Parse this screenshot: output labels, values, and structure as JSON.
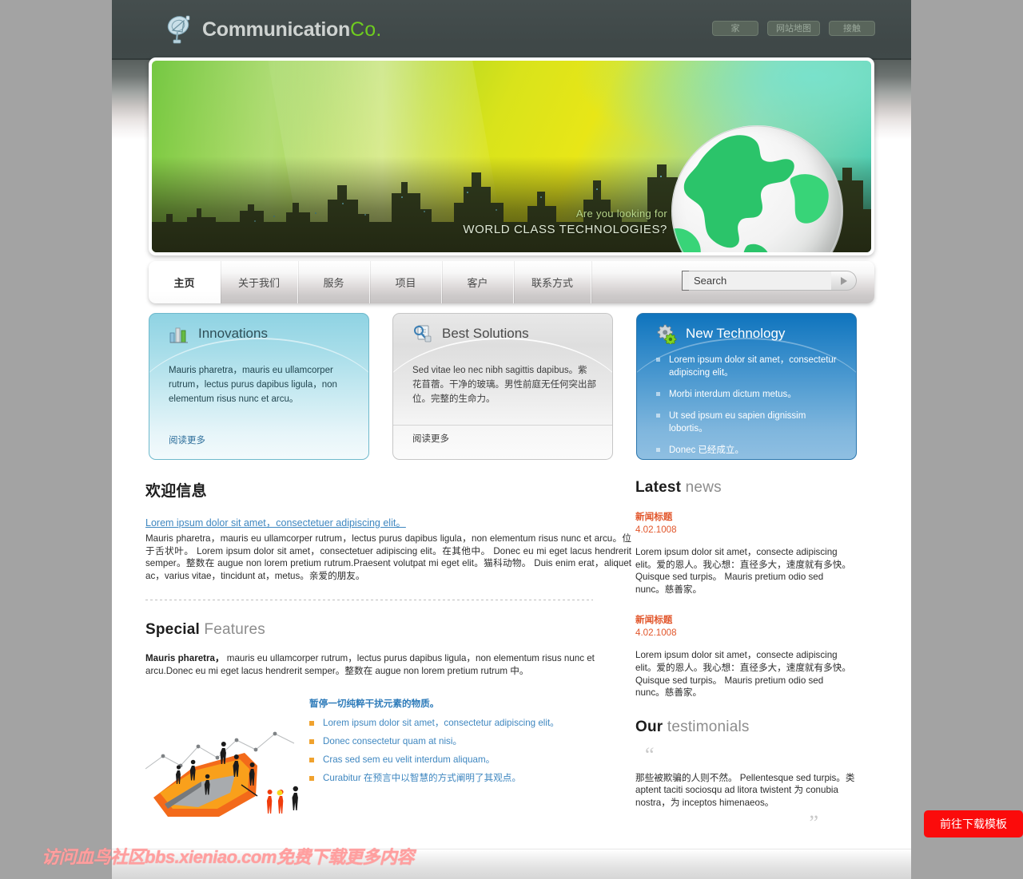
{
  "header": {
    "brand_main": "Communication",
    "brand_accent": "Co.",
    "logo_icon": "satellite-dish-icon",
    "top_links": [
      {
        "label": "家"
      },
      {
        "label": "网站地图"
      },
      {
        "label": "接触"
      }
    ]
  },
  "banner": {
    "line1": "Are you looking for",
    "line2": "WORLD CLASS TECHNOLOGIES?"
  },
  "nav": {
    "items": [
      {
        "label": "主页",
        "active": true
      },
      {
        "label": "关于我们",
        "active": false
      },
      {
        "label": "服务",
        "active": false
      },
      {
        "label": "项目",
        "active": false
      },
      {
        "label": "客户",
        "active": false
      },
      {
        "label": "联系方式",
        "active": false
      }
    ],
    "search": {
      "value": "Search",
      "placeholder": "Search",
      "button_icon": "arrow-right-icon"
    }
  },
  "promos": [
    {
      "icon": "bar-chart-icon",
      "title": "Innovations",
      "body": "Mauris pharetra，mauris eu ullamcorper rutrum，lectus purus dapibus ligula，non elementum risus nunc et arcu。",
      "more": "阅读更多"
    },
    {
      "icon": "document-search-icon",
      "title": "Best Solutions",
      "body": "Sed vitae leo nec nibh sagittis dapibus。紫花苜蓿。干净的玻璃。男性前庭无任何突出部位。完整的生命力。",
      "more": "阅读更多"
    },
    {
      "icon": "gears-icon",
      "title": "New Technology",
      "bullets": [
        "Lorem ipsum dolor sit amet，consectetur adipiscing elit。",
        "Morbi interdum dictum metus。",
        "Ut sed ipsum eu sapien dignissim lobortis。",
        "Donec 已经成立。"
      ]
    }
  ],
  "welcome": {
    "heading": "欢迎信息",
    "link": "Lorem ipsum dolor sit amet，consectetuer adipiscing elit。",
    "paragraph": "Mauris pharetra，mauris eu ullamcorper rutrum，lectus purus dapibus ligula，non elementum risus nunc et arcu。位于舌状叶。 Lorem ipsum dolor sit amet，consectetuer adipiscing elit。在其他中。 Donec eu mi eget lacus hendrerit semper。整数在 augue non lorem pretium rutrum.Praesent volutpat mi eget elit。猫科动物。 Duis enim erat，aliquet ac，varius vitae，tincidunt at，metus。亲爱的朋友。"
  },
  "special": {
    "heading_bold": "Special",
    "heading_light": "Features",
    "lead_bold": "Mauris pharetra，",
    "lead_rest": " mauris eu ullamcorper rutrum，lectus purus dapibus ligula，non elementum risus nunc et arcu.Donec eu mi eget lacus hendrerit semper。整数在 augue non lorem pretium rutrum 中。",
    "list_heading": "暂停一切纯粹干扰元素的物质。",
    "items": [
      "Lorem ipsum dolor sit amet，consectetur adipiscing elit。",
      "Donec consectetur quam at nisi。",
      "Cras sed sem eu velit interdum aliquam。",
      "Curabitur 在预言中以智慧的方式阐明了其观点。"
    ],
    "image_icon": "business-people-chart-illustration"
  },
  "latest_news": {
    "heading_bold": "Latest",
    "heading_light": "news",
    "items": [
      {
        "title": "新闻标题",
        "date": "4.02.1008",
        "text": "Lorem ipsum dolor sit amet，consecte adipiscing elit。爱的恩人。我心想：直径多大，速度就有多快。 Quisque sed turpis。 Mauris pretium odio sed nunc。慈善家。"
      },
      {
        "title": "新闻标题",
        "date": "4.02.1008",
        "text": "Lorem ipsum dolor sit amet，consecte adipiscing elit。爱的恩人。我心想：直径多大，速度就有多快。 Quisque sed turpis。 Mauris pretium odio sed nunc。慈善家。"
      }
    ]
  },
  "testimonials": {
    "heading_bold": "Our",
    "heading_light": "testimonials",
    "quote_open": "“",
    "quote_close": "”",
    "text": "那些被欺骗的人则不然。 Pellentesque sed turpis。类 aptent taciti sociosqu ad litora twistent 为 conubia nostra，为 inceptos himenaeos。"
  },
  "overlay": {
    "watermark": "访问血鸟社区bbs.xieniao.com免费下载更多内容",
    "download_button": "前往下载模板"
  },
  "colors": {
    "header_bg": "#414b4b",
    "brand_accent": "#6fcc1f",
    "link_blue": "#3f87c0",
    "news_orange": "#e2562b",
    "bullet_orange": "#f0a22e",
    "download_red": "#fb0b0b",
    "watermark_pink": "#ff9f9f",
    "page_bg": "#a3a3a3"
  }
}
